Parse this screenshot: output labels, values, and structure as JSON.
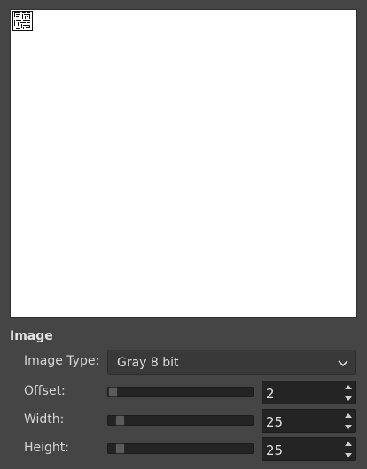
{
  "section_title": "Image",
  "image_type": {
    "label": "Image Type:",
    "value": "Gray 8 bit"
  },
  "offset": {
    "label": "Offset:",
    "value": "2",
    "slider_fraction": 0.0
  },
  "width": {
    "label": "Width:",
    "value": "25",
    "slider_fraction": 0.05
  },
  "height": {
    "label": "Height:",
    "value": "25",
    "slider_fraction": 0.05
  },
  "icons": {
    "combo_arrow": "chevron-down-icon",
    "spin_up": "chevron-up-icon",
    "spin_down": "chevron-down-icon"
  },
  "colors": {
    "panel_bg": "#454545",
    "preview_bg": "#ffffff",
    "input_bg": "#242424"
  }
}
